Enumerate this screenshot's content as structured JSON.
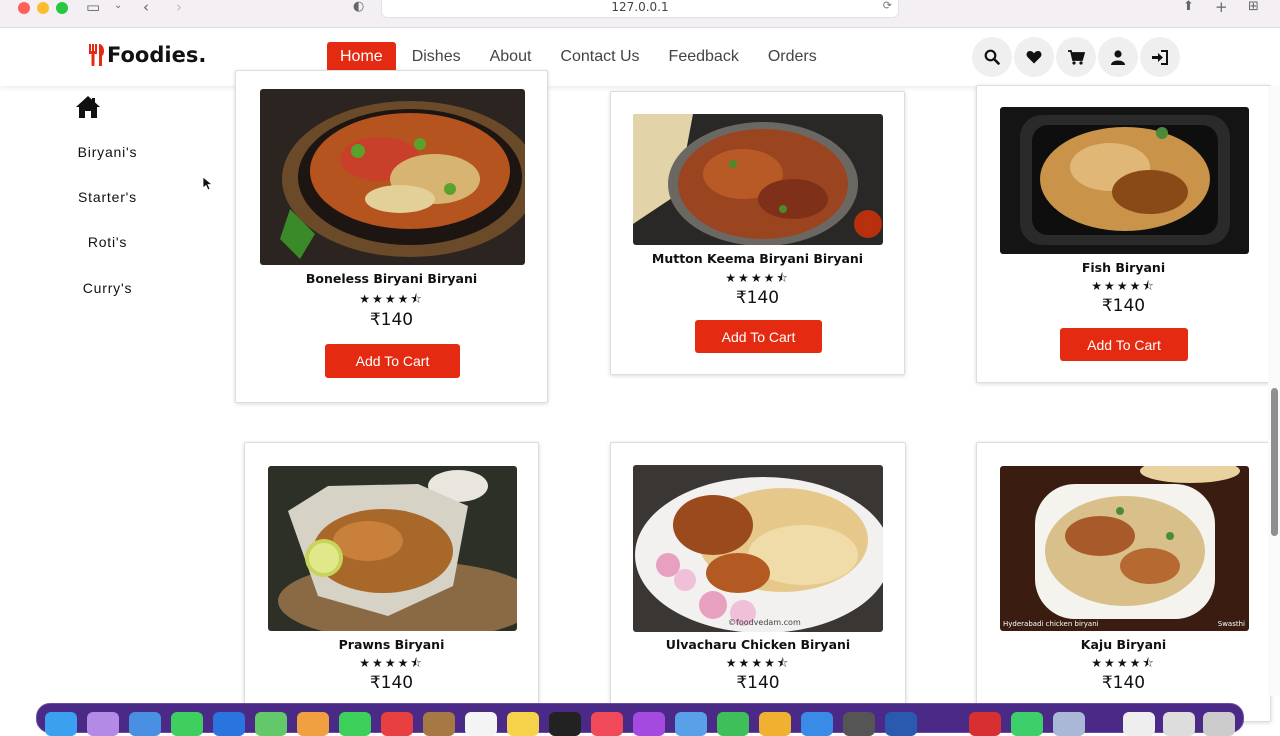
{
  "browser": {
    "url": "127.0.0.1"
  },
  "brand": {
    "name": "Foodies.",
    "accent_color": "#e42b12"
  },
  "nav": {
    "items": [
      "Home",
      "Dishes",
      "About",
      "Contact Us",
      "Feedback",
      "Orders"
    ],
    "active": "Home"
  },
  "header_icons": [
    "search-icon",
    "heart-icon",
    "cart-icon",
    "user-icon",
    "login-icon"
  ],
  "sidebar": {
    "icon": "home-icon",
    "items": [
      "Biryani's",
      "Starter's",
      "Roti's",
      "Curry's"
    ]
  },
  "cards": [
    {
      "name": "Boneless Biryani Biryani",
      "rating_stars": 4.5,
      "price": "₹140",
      "button": "Add To Cart"
    },
    {
      "name": "Mutton Keema Biryani Biryani",
      "rating_stars": 4.5,
      "price": "₹140",
      "button": "Add To Cart"
    },
    {
      "name": "Fish Biryani",
      "rating_stars": 4.5,
      "price": "₹140",
      "button": "Add To Cart"
    },
    {
      "name": "Prawns Biryani",
      "rating_stars": 4.5,
      "price": "₹140"
    },
    {
      "name": "Ulvacharu Chicken Biryani",
      "rating_stars": 4.5,
      "price": "₹140",
      "image_watermark": "©foodvedam.com"
    },
    {
      "name": "Kaju Biryani",
      "rating_stars": 4.5,
      "price": "₹140",
      "image_caption_left": "Hyderabadi chicken biryani",
      "image_caption_right": "Swasthi"
    }
  ],
  "stars_text": "★★★★⯪"
}
